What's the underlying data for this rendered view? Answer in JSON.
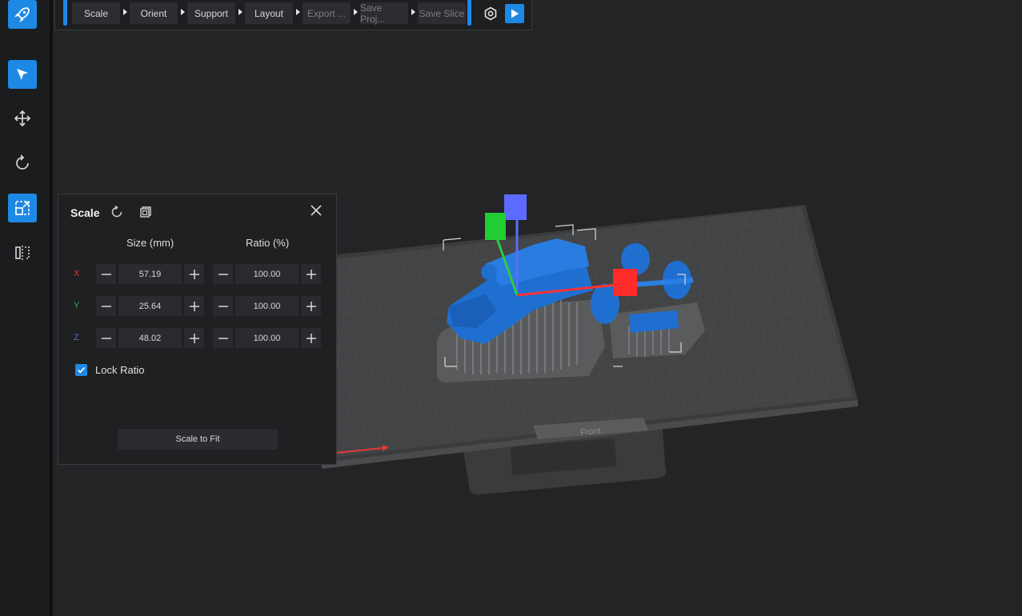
{
  "toolbar": {
    "steps": [
      "Scale",
      "Orient",
      "Support",
      "Layout",
      "Export ...",
      "Save Proj...",
      "Save Slice"
    ],
    "icons": [
      "settings-icon",
      "play-icon"
    ]
  },
  "sidebar": {
    "tools": [
      "rocket-icon",
      "select-icon",
      "move-icon",
      "rotate-icon",
      "scale-icon",
      "mirror-icon"
    ]
  },
  "panel": {
    "title": "Scale",
    "size_header": "Size (mm)",
    "ratio_header": "Ratio (%)",
    "rows": [
      {
        "axis": "X",
        "size": "57.19",
        "ratio": "100.00",
        "color": "#e53935"
      },
      {
        "axis": "Y",
        "size": "25.64",
        "ratio": "100.00",
        "color": "#43a047"
      },
      {
        "axis": "Z",
        "size": "48.02",
        "ratio": "100.00",
        "color": "#5c6bc0"
      }
    ],
    "lock_label": "Lock Ratio",
    "lock_checked": true,
    "fit_button": "Scale to Fit"
  },
  "viewport": {
    "front_label": "Front"
  },
  "colors": {
    "accent": "#1e88e5",
    "model": "#1f6fd1"
  }
}
